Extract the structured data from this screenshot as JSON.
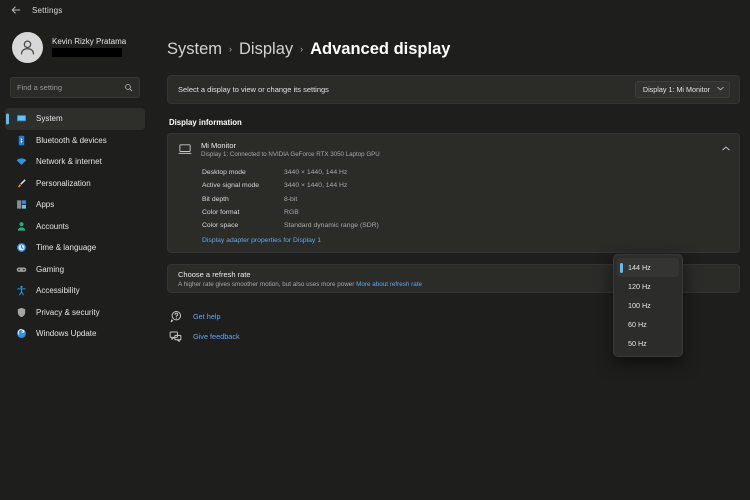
{
  "titlebar": {
    "back_label": "back-arrow",
    "title": "Settings"
  },
  "account": {
    "name": "Kevin Rizky Pratama",
    "email_redacted": true
  },
  "search": {
    "placeholder": "Find a setting",
    "value": "",
    "icon": "search-icon"
  },
  "sidebar": {
    "items": [
      {
        "label": "System",
        "icon": "system-icon",
        "selected": true
      },
      {
        "label": "Bluetooth & devices",
        "icon": "bluetooth-icon",
        "selected": false
      },
      {
        "label": "Network & internet",
        "icon": "wifi-icon",
        "selected": false
      },
      {
        "label": "Personalization",
        "icon": "paintbrush-icon",
        "selected": false
      },
      {
        "label": "Apps",
        "icon": "apps-icon",
        "selected": false
      },
      {
        "label": "Accounts",
        "icon": "accounts-icon",
        "selected": false
      },
      {
        "label": "Time & language",
        "icon": "clock-icon",
        "selected": false
      },
      {
        "label": "Gaming",
        "icon": "gaming-icon",
        "selected": false
      },
      {
        "label": "Accessibility",
        "icon": "accessibility-icon",
        "selected": false
      },
      {
        "label": "Privacy & security",
        "icon": "shield-icon",
        "selected": false
      },
      {
        "label": "Windows Update",
        "icon": "update-icon",
        "selected": false
      }
    ]
  },
  "breadcrumb": {
    "root": "System",
    "parent": "Display",
    "current": "Advanced display",
    "separator": "›"
  },
  "display_selector": {
    "label": "Select a display to view or change its settings",
    "selected": "Display 1: Mi Monitor",
    "caret": "⌄"
  },
  "display_information": {
    "section_title": "Display information",
    "monitor_name": "Mi Monitor",
    "monitor_sub": "Display 1: Connected to NVIDIA GeForce RTX 3050 Laptop GPU",
    "collapse_caret": "⌃",
    "specs": [
      {
        "key": "Desktop mode",
        "value": "3440 × 1440, 144 Hz"
      },
      {
        "key": "Active signal mode",
        "value": "3440 × 1440, 144 Hz"
      },
      {
        "key": "Bit depth",
        "value": "8-bit"
      },
      {
        "key": "Color format",
        "value": "RGB"
      },
      {
        "key": "Color space",
        "value": "Standard dynamic range (SDR)"
      }
    ],
    "adapter_link": "Display adapter properties for Display 1"
  },
  "refresh_rate": {
    "title": "Choose a refresh rate",
    "subtitle": "A higher rate gives smoother motion, but also uses more power",
    "more_link": "More about refresh rate",
    "selected": "144 Hz",
    "options": [
      {
        "label": "144 Hz",
        "selected": true
      },
      {
        "label": "120 Hz",
        "selected": false
      },
      {
        "label": "100 Hz",
        "selected": false
      },
      {
        "label": "60 Hz",
        "selected": false
      },
      {
        "label": "50 Hz",
        "selected": false
      }
    ],
    "dropdown_open": true
  },
  "footer": {
    "links": [
      {
        "label": "Get help",
        "icon": "help-icon"
      },
      {
        "label": "Give feedback",
        "icon": "feedback-icon"
      }
    ]
  },
  "colors": {
    "accent": "#4cc2ff",
    "link": "#64a8e8",
    "app_background": "#1e1e1c",
    "card_background": "#2b2b28"
  }
}
